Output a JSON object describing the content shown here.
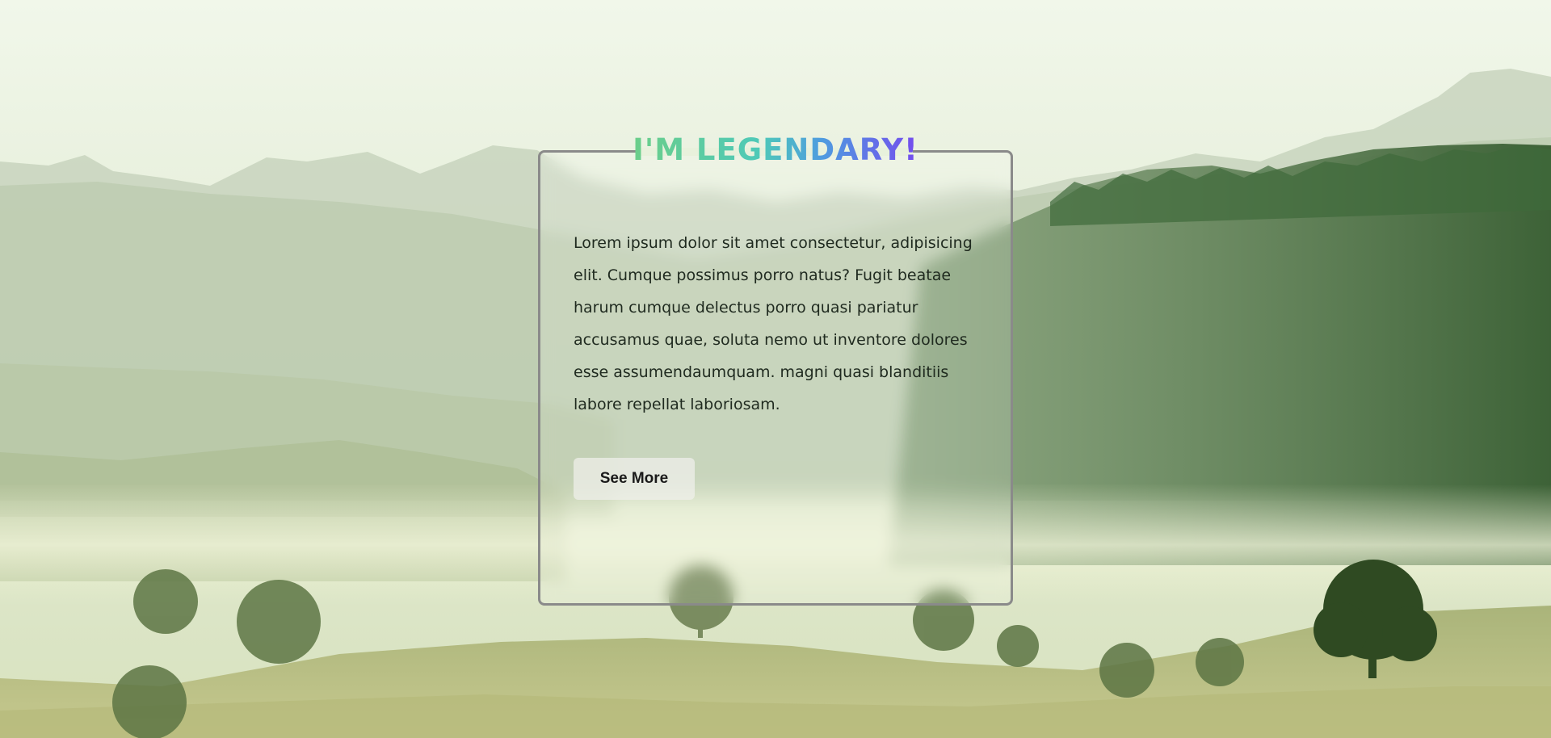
{
  "card": {
    "title": "I'M LEGENDARY!",
    "body": "Lorem ipsum dolor sit amet consectetur, adipisicing elit. Cumque possimus porro natus? Fugit beatae harum cumque delectus porro quasi pariatur accusamus quae, soluta nemo ut inventore dolores esse assumendaumquam. magni quasi blanditiis labore repellat laboriosam.",
    "button_label": "See More"
  },
  "colors": {
    "title_gradient_start": "#6fcf84",
    "title_gradient_mid": "#4f9be0",
    "title_gradient_end": "#7a3ff0",
    "card_border": "#8a8a8a",
    "sky": "#eef5e6",
    "forest": "#3f6a3a"
  }
}
